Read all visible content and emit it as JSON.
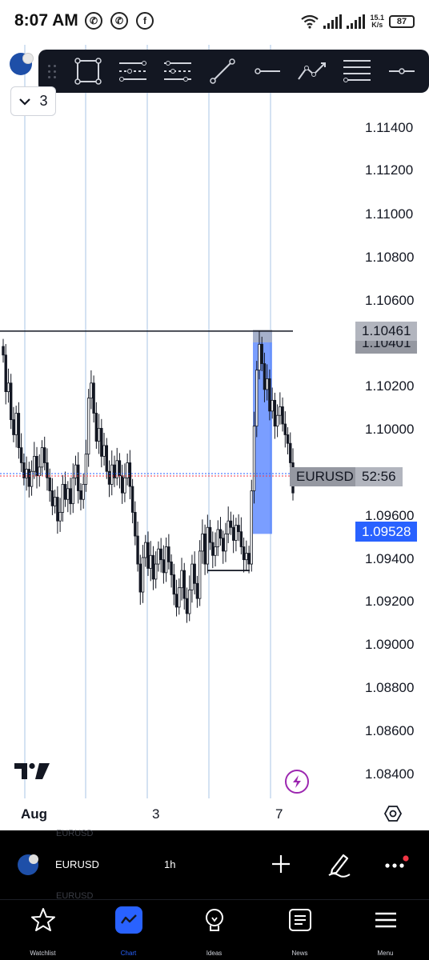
{
  "status_bar": {
    "time": "8:07 AM",
    "apps": [
      "whatsapp-icon",
      "whatsapp-icon",
      "facebook-icon"
    ],
    "net_speed_value": "15.1",
    "net_speed_unit": "K/s",
    "battery": "87"
  },
  "symbol": {
    "name": "EURUSD",
    "interval": "1h",
    "collapsed_count": "3"
  },
  "toolbar": {
    "tools": [
      "rectangle-icon",
      "parallel-channel-icon",
      "pitchfork-icon",
      "trend-line-icon",
      "horizontal-ray-icon",
      "path-icon",
      "fib-retracement-icon",
      "horizontal-line-icon"
    ]
  },
  "price_axis": {
    "labels": [
      "1.11400",
      "1.11200",
      "1.11000",
      "1.10800",
      "1.10600",
      "1.10200",
      "1.10000",
      "1.09600",
      "1.09400",
      "1.09200",
      "1.09000",
      "1.08800",
      "1.08600",
      "1.08400"
    ],
    "line_price_tag": "1.10461",
    "line_price_tag_behind": "1.10401",
    "symbol_tag": "EURUSD",
    "countdown": "52:56",
    "current_price": "1.09528",
    "current_price_hidden_suffix": "0"
  },
  "time_axis": {
    "labels": [
      "Aug",
      "3",
      "7"
    ]
  },
  "chart_data": {
    "type": "candlestick",
    "symbol": "EURUSD",
    "interval": "1h",
    "ylim": [
      1.083,
      1.1162
    ],
    "current_price": 1.09528,
    "horizontal_line": 1.10461,
    "rectangle": {
      "top": 1.10461,
      "bottom": 1.0952
    },
    "support_segment": 1.0935,
    "closes": [
      1.1035,
      1.1018,
      1.1022,
      1.1005,
      1.0998,
      1.1008,
      1.0992,
      1.0985,
      1.0978,
      1.0982,
      1.0974,
      1.0981,
      1.0988,
      1.0979,
      1.0983,
      1.0992,
      1.0985,
      1.0978,
      1.0972,
      1.0965,
      1.0969,
      1.0958,
      1.0962,
      1.0975,
      1.0968,
      1.0973,
      1.0966,
      1.0978,
      1.0984,
      1.0972,
      1.0968,
      1.0975,
      1.0989,
      1.1015,
      1.1022,
      1.1008,
      1.0995,
      1.1001,
      1.0988,
      1.0993,
      1.0981,
      1.0975,
      1.0984,
      1.0978,
      1.0986,
      1.0979,
      1.0971,
      1.0978,
      1.0985,
      1.0974,
      1.0962,
      1.0951,
      1.0938,
      1.0925,
      1.0941,
      1.0948,
      1.0936,
      1.0942,
      1.0931,
      1.0938,
      1.0945,
      1.094,
      1.0934,
      1.0946,
      1.0939,
      1.0933,
      1.0924,
      1.0918,
      1.0927,
      1.0935,
      1.0922,
      1.0915,
      1.0926,
      1.0938,
      1.0929,
      1.0922,
      1.0944,
      1.0952,
      1.0938,
      1.0955,
      1.0948,
      1.0942,
      1.0946,
      1.0954,
      1.095,
      1.0944,
      1.0952,
      1.0958,
      1.0955,
      1.0949,
      1.0956,
      1.0953,
      1.0946,
      1.094,
      1.0943,
      1.0938,
      1.0972,
      1.1002,
      1.1028,
      1.104,
      1.1031,
      1.1019,
      1.1024,
      1.1009,
      1.1014,
      1.1002,
      1.1007,
      1.1011,
      1.1003,
      1.0998,
      1.0994,
      1.0985,
      1.0971
    ]
  }
}
